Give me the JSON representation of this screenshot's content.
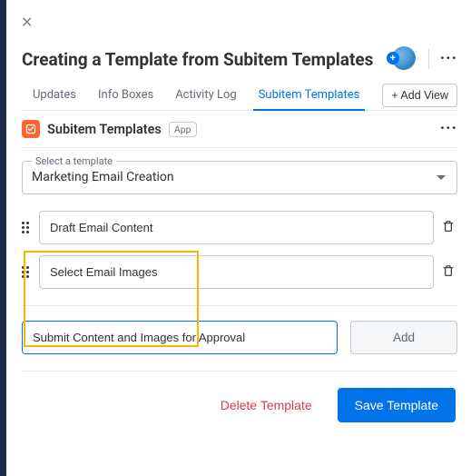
{
  "header": {
    "title": "Creating a Template from Subitem Templates"
  },
  "tabs": {
    "list": [
      {
        "label": "Updates",
        "active": false
      },
      {
        "label": "Info Boxes",
        "active": false
      },
      {
        "label": "Activity Log",
        "active": false
      },
      {
        "label": "Subitem Templates",
        "active": true
      }
    ],
    "add_view_label": "+ Add View"
  },
  "app": {
    "title": "Subitem Templates",
    "badge": "App"
  },
  "template_select": {
    "legend": "Select a template",
    "value": "Marketing Email Creation"
  },
  "subitems": [
    {
      "value": "Draft Email Content"
    },
    {
      "value": "Select Email Images"
    }
  ],
  "add_row": {
    "input_value": "Submit Content and Images for Approval",
    "button_label": "Add"
  },
  "footer": {
    "delete_label": "Delete Template",
    "save_label": "Save Template"
  },
  "colors": {
    "accent": "#0073ea",
    "danger": "#d83a52",
    "highlight": "#f5b800",
    "app_icon": "#ff642e"
  }
}
